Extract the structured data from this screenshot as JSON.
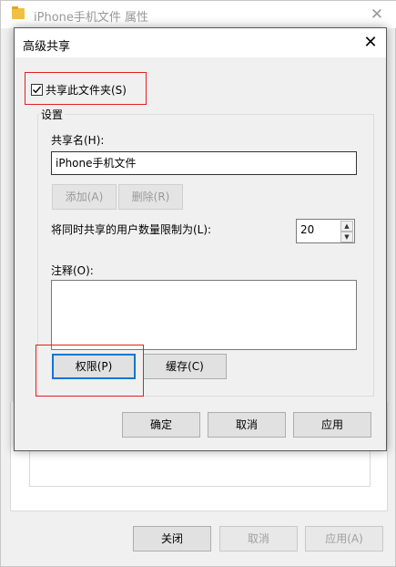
{
  "background_window": {
    "title": "iPhone手机文件 属性",
    "buttons": {
      "close": "关闭",
      "cancel": "取消",
      "apply": "应用(A)"
    }
  },
  "dialog": {
    "title": "高级共享",
    "share_folder_label": "共享此文件夹(S)",
    "share_folder_checked": true,
    "settings_group_label": "设置",
    "share_name_label": "共享名(H):",
    "share_name_value": "iPhone手机文件",
    "add_button": "添加(A)",
    "remove_button": "删除(R)",
    "user_limit_label": "将同时共享的用户数量限制为(L):",
    "user_limit_value": "20",
    "comment_label": "注释(O):",
    "comment_value": "",
    "permissions_button": "权限(P)",
    "caching_button": "缓存(C)",
    "ok_button": "确定",
    "cancel_button": "取消",
    "apply_button": "应用"
  },
  "colors": {
    "highlight": "#e02020",
    "focus": "#0078d7"
  }
}
